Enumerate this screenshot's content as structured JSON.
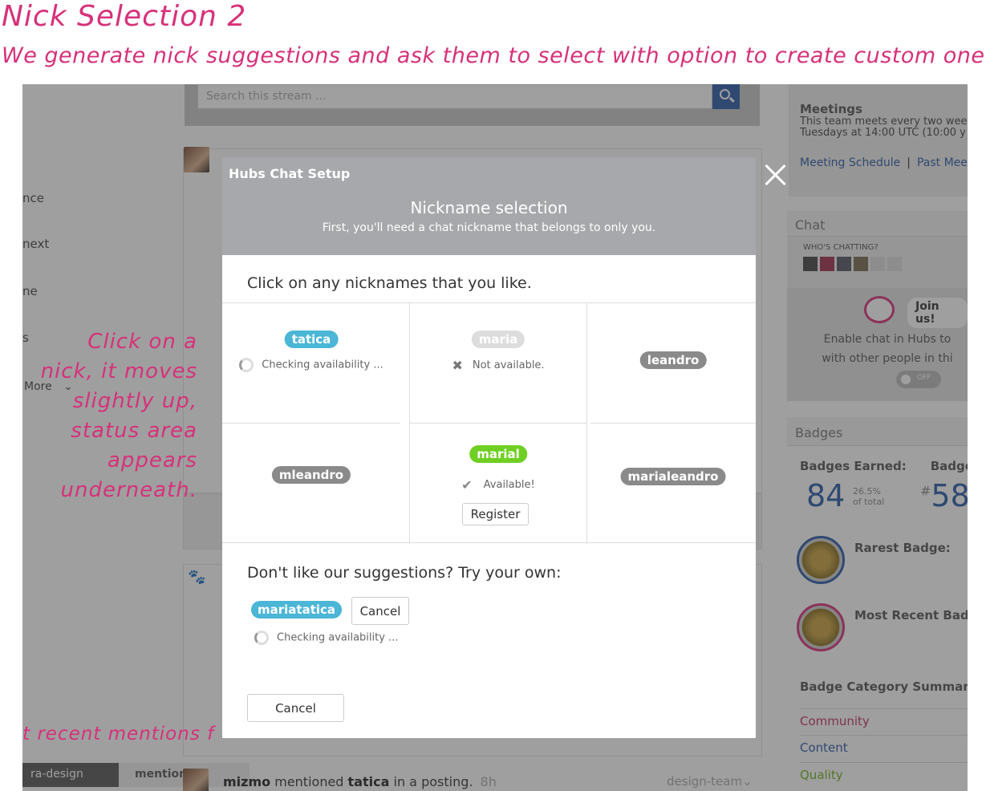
{
  "annotations": {
    "title": "Nick Selection 2",
    "subtitle": "We generate nick suggestions and ask them to select with option to create custom one",
    "click_note": "Click on a nick, it moves slightly up, status area appears underneath.",
    "mentions_note": "t recent mentions f"
  },
  "background": {
    "nav_items": [
      "nce",
      "next",
      "ne",
      "s",
      "More"
    ],
    "search_placeholder": "Search this stream ...",
    "meetings": {
      "title": "Meetings",
      "line1": "This team meets every two wee",
      "line2": "Tuesdays at 14:00 UTC (10:00 y",
      "link1": "Meeting Schedule",
      "sep": "|",
      "link2": "Past Meet"
    },
    "chat": {
      "title": "Chat",
      "who": "WHO'S CHATTING?",
      "join": "Join us!",
      "enable1": "Enable chat in Hubs to",
      "enable2": "with other people in thi",
      "toggle": "OFF"
    },
    "badges": {
      "title": "Badges",
      "earned_label": "Badges Earned:",
      "rank_label": "Badge",
      "earned": "84",
      "pct": "26.5%",
      "pct_label": "of total",
      "rank_prefix": "#",
      "rank": "58",
      "rarest": "Rarest Badge:",
      "recent": "Most Recent Badg",
      "category": "Badge Category Summary:",
      "cat1": "Community",
      "cat2": "Content",
      "cat3": "Quality"
    },
    "mentions": {
      "tab1": "ra-design",
      "tab2": "mentions",
      "user": "mizmo",
      "verb": "mentioned",
      "target": "tatica",
      "rest": "in a posting.",
      "time": "8h",
      "team": "design-team"
    }
  },
  "modal": {
    "app_title": "Hubs Chat Setup",
    "title": "Nickname selection",
    "subtitle": "First, you'll need a chat nickname that belongs to only you.",
    "prompt": "Click on any nicknames that you like.",
    "nicks": [
      {
        "name": "tatica",
        "status": "Checking availability ..."
      },
      {
        "name": "maria",
        "status": "Not available."
      },
      {
        "name": "leandro",
        "status": ""
      },
      {
        "name": "mleandro",
        "status": ""
      },
      {
        "name": "marial",
        "status": "Available!",
        "action": "Register"
      },
      {
        "name": "marialeandro",
        "status": ""
      }
    ],
    "custom_prompt": "Don't like our suggestions? Try your own:",
    "custom_nick": "mariatatica",
    "custom_cancel": "Cancel",
    "custom_status": "Checking availability ...",
    "cancel": "Cancel"
  },
  "colors": {
    "accent": "#d6317a",
    "pill_blue": "#4bb6d6",
    "pill_gray": "#8a8a8a",
    "pill_green": "#6fcf22",
    "header_gray": "#a7a8ab"
  }
}
